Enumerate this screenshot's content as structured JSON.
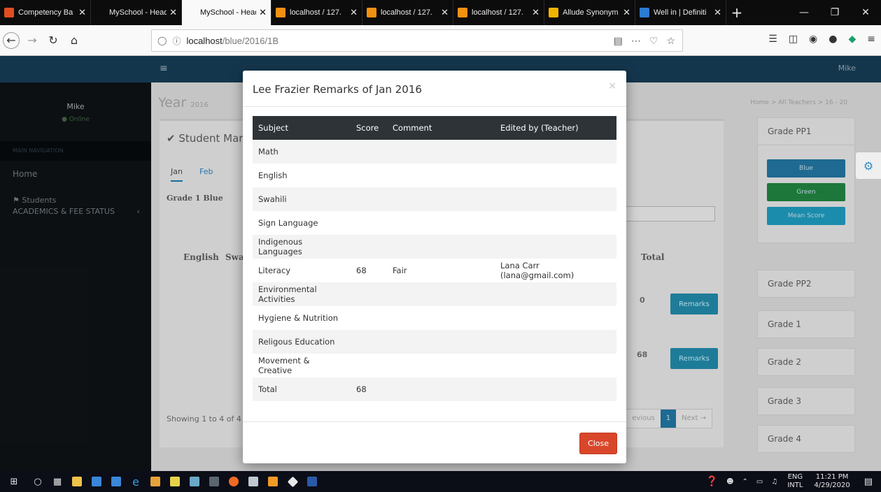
{
  "browser": {
    "tabs": [
      {
        "title": "Competency Ba",
        "color": "#e04e20"
      },
      {
        "title": "MySchool - HeadTe",
        "color": ""
      },
      {
        "title": "MySchool - HeadTe",
        "color": "",
        "active": true
      },
      {
        "title": "localhost / 127.",
        "color": "#f29111"
      },
      {
        "title": "localhost / 127.",
        "color": "#f29111"
      },
      {
        "title": "localhost / 127.",
        "color": "#f29111"
      },
      {
        "title": "Allude Synonym",
        "color": "#f0b400"
      },
      {
        "title": "Well in | Definiti",
        "color": "#2c7bd4"
      }
    ],
    "url_host": "localhost",
    "url_path": "/blue/2016/1B"
  },
  "app": {
    "header_user": "Mike",
    "sidebar": {
      "user_name": "Mike",
      "status": "Online",
      "main_nav": "MAIN NAVIGATION",
      "home": "Home",
      "students": "Students",
      "academics": "ACADEMICS & FEE STATUS"
    },
    "page_title": "Year",
    "page_title_small": "2016",
    "breadcrumb": "Home > All Teachers > 16 - 20",
    "panel_title": "Student Mark",
    "months": [
      "Jan",
      "Feb"
    ],
    "grade_label": "Grade 1 Blue",
    "col_english": "English",
    "col_swa": "Swa",
    "col_total": "Total",
    "row_totals": [
      "0",
      "68"
    ],
    "remarks_label": "Remarks",
    "showing": "Showing 1 to 4 of 4",
    "pager_prev": "evious",
    "pager_current": "1",
    "pager_next": "Next →",
    "grade_cards": [
      "Grade PP1",
      "Grade PP2",
      "Grade 1",
      "Grade 2",
      "Grade 3",
      "Grade 4"
    ],
    "grade_buttons": [
      {
        "label": "Blue",
        "color": "#1f6d95"
      },
      {
        "label": "Green",
        "color": "#1f7a3c"
      },
      {
        "label": "Mean Score",
        "color": "#1d8fb0"
      }
    ]
  },
  "modal": {
    "title": "Lee Frazier Remarks of Jan 2016",
    "close_x": "×",
    "headers": [
      "Subject",
      "Score",
      "Comment",
      "Edited by (Teacher)"
    ],
    "rows": [
      {
        "subject": "Math",
        "score": "",
        "comment": "",
        "teacher": ""
      },
      {
        "subject": "English",
        "score": "",
        "comment": "",
        "teacher": ""
      },
      {
        "subject": "Swahili",
        "score": "",
        "comment": "",
        "teacher": ""
      },
      {
        "subject": "Sign Language",
        "score": "",
        "comment": "",
        "teacher": ""
      },
      {
        "subject": "Indigenous Languages",
        "score": "",
        "comment": "",
        "teacher": ""
      },
      {
        "subject": "Literacy",
        "score": "68",
        "comment": "Fair",
        "teacher": "Lana Carr (lana@gmail.com)"
      },
      {
        "subject": "Environmental Activities",
        "score": "",
        "comment": "",
        "teacher": ""
      },
      {
        "subject": "Hygiene & Nutrition",
        "score": "",
        "comment": "",
        "teacher": ""
      },
      {
        "subject": "Religous Education",
        "score": "",
        "comment": "",
        "teacher": ""
      },
      {
        "subject": "Movement & Creative",
        "score": "",
        "comment": "",
        "teacher": ""
      },
      {
        "subject": "Total",
        "score": "68",
        "comment": "",
        "teacher": ""
      }
    ],
    "close_label": "Close"
  },
  "taskbar": {
    "lang": "ENG",
    "lang2": "INTL",
    "time": "11:21 PM",
    "date": "4/29/2020"
  }
}
